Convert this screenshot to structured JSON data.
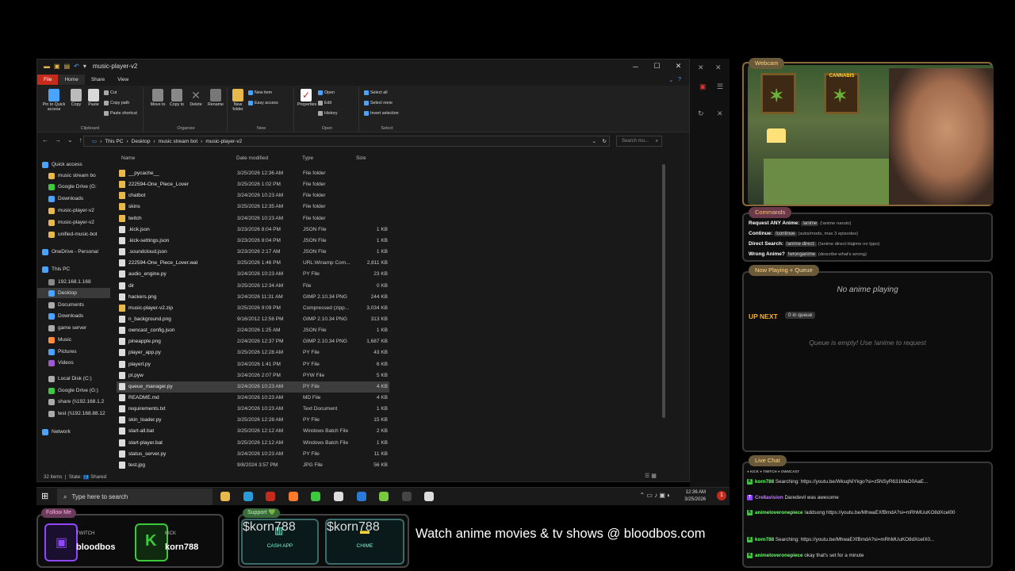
{
  "window": {
    "title": "music-player-v2",
    "controls": {
      "minimize": "─",
      "maximize": "☐",
      "close": "✕"
    }
  },
  "menu": {
    "file": "File",
    "home": "Home",
    "share": "Share",
    "view": "View"
  },
  "ribbon": {
    "pin": "Pin to Quick access",
    "copy": "Copy",
    "paste": "Paste",
    "cut": "Cut",
    "copy_path": "Copy path",
    "paste_shortcut": "Paste shortcut",
    "clipboard": "Clipboard",
    "move_to": "Move to",
    "copy_to": "Copy to",
    "delete": "Delete",
    "rename": "Rename",
    "organize": "Organize",
    "new_folder": "New folder",
    "new_item": "New item",
    "easy_access": "Easy access",
    "new": "New",
    "properties": "Properties",
    "open_btn": "Open",
    "edit": "Edit",
    "history": "History",
    "open": "Open",
    "select_all": "Select all",
    "select_none": "Select none",
    "invert": "Invert selection",
    "select": "Select"
  },
  "address": {
    "crumbs": [
      "This PC",
      "Desktop",
      "music stream bot",
      "music-player-v2"
    ],
    "search_placeholder": "Search mu..."
  },
  "nav": {
    "items": [
      {
        "label": "Quick access",
        "color": "#4aa3ff"
      },
      {
        "label": "music stream bo",
        "color": "#e8b94a"
      },
      {
        "label": "Google Drive (G:",
        "color": "#3ec83e"
      },
      {
        "label": "Downloads",
        "color": "#4aa3ff"
      },
      {
        "label": "music-player-v2",
        "color": "#e8b94a"
      },
      {
        "label": "music-player-v2",
        "color": "#e8b94a"
      },
      {
        "label": "unified-music-bot",
        "color": "#e8b94a"
      },
      {
        "label": "OneDrive - Personal",
        "color": "#4aa3ff"
      },
      {
        "label": "This PC",
        "color": "#4aa3ff"
      },
      {
        "label": "192.168.1.168",
        "color": "#888888"
      },
      {
        "label": "Desktop",
        "color": "#4aa3ff"
      },
      {
        "label": "Documents",
        "color": "#aaaaaa"
      },
      {
        "label": "Downloads",
        "color": "#4aa3ff"
      },
      {
        "label": "game server",
        "color": "#aaaaaa"
      },
      {
        "label": "Music",
        "color": "#ff8c3a"
      },
      {
        "label": "Pictures",
        "color": "#4aa3ff"
      },
      {
        "label": "Videos",
        "color": "#a05ad0"
      },
      {
        "label": "Local Disk (C:)",
        "color": "#aaaaaa"
      },
      {
        "label": "Google Drive (G:)",
        "color": "#3ec83e"
      },
      {
        "label": "share (\\\\192.168.1.2",
        "color": "#aaaaaa"
      },
      {
        "label": "test (\\\\192.168.88.12",
        "color": "#aaaaaa"
      },
      {
        "label": "Network",
        "color": "#4aa3ff"
      }
    ]
  },
  "columns": {
    "name": "Name",
    "date": "Date modified",
    "type": "Type",
    "size": "Size"
  },
  "files": [
    {
      "name": "__pycache__",
      "date": "3/25/2026 12:36 AM",
      "type": "File folder",
      "size": "",
      "color": "#e8b94a"
    },
    {
      "name": "222594-One_Piece_Lover",
      "date": "3/25/2026 1:02 PM",
      "type": "File folder",
      "size": "",
      "color": "#e8b94a"
    },
    {
      "name": "chatbot",
      "date": "3/24/2026 10:23 AM",
      "type": "File folder",
      "size": "",
      "color": "#e8b94a"
    },
    {
      "name": "skins",
      "date": "3/25/2026 12:35 AM",
      "type": "File folder",
      "size": "",
      "color": "#e8b94a"
    },
    {
      "name": "twitch",
      "date": "3/24/2026 10:23 AM",
      "type": "File folder",
      "size": "",
      "color": "#e8b94a"
    },
    {
      "name": ".kick.json",
      "date": "3/23/2026 8:04 PM",
      "type": "JSON File",
      "size": "1 KB",
      "color": "#dddddd"
    },
    {
      "name": ".kick-settings.json",
      "date": "3/23/2026 8:04 PM",
      "type": "JSON File",
      "size": "1 KB",
      "color": "#dddddd"
    },
    {
      "name": ".soundcloud.json",
      "date": "3/23/2026 2:17 AM",
      "type": "JSON File",
      "size": "1 KB",
      "color": "#dddddd"
    },
    {
      "name": "222594-One_Piece_Lover.wal",
      "date": "3/25/2026 1:46 PM",
      "type": "URL:Winamp Com...",
      "size": "2,811 KB",
      "color": "#dddddd"
    },
    {
      "name": "audio_engine.py",
      "date": "3/24/2026 10:23 AM",
      "type": "PY File",
      "size": "23 KB",
      "color": "#dddddd"
    },
    {
      "name": "dir",
      "date": "3/25/2026 12:34 AM",
      "type": "File",
      "size": "0 KB",
      "color": "#dddddd"
    },
    {
      "name": "hackers.png",
      "date": "3/24/2026 11:31 AM",
      "type": "GIMP 2.10.34 PNG",
      "size": "244 KB",
      "color": "#dddddd"
    },
    {
      "name": "music-player-v2.zip",
      "date": "3/25/2026 9:09 PM",
      "type": "Compressed (zipp...",
      "size": "3,034 KB",
      "color": "#e8b94a"
    },
    {
      "name": "n_background.png",
      "date": "9/16/2012 12:56 PM",
      "type": "GIMP 2.10.34 PNG",
      "size": "313 KB",
      "color": "#dddddd"
    },
    {
      "name": "owncast_config.json",
      "date": "2/24/2026 1:25 AM",
      "type": "JSON File",
      "size": "1 KB",
      "color": "#dddddd"
    },
    {
      "name": "pineapple.png",
      "date": "2/24/2026 12:37 PM",
      "type": "GIMP 2.10.34 PNG",
      "size": "1,687 KB",
      "color": "#dddddd"
    },
    {
      "name": "player_app.py",
      "date": "3/25/2026 12:28 AM",
      "type": "PY File",
      "size": "43 KB",
      "color": "#dddddd"
    },
    {
      "name": "playerl.py",
      "date": "3/24/2026 1:41 PM",
      "type": "PY File",
      "size": "6 KB",
      "color": "#dddddd"
    },
    {
      "name": "pt.pyw",
      "date": "3/24/2026 2:07 PM",
      "type": "PYW File",
      "size": "5 KB",
      "color": "#dddddd"
    },
    {
      "name": "queue_manager.py",
      "date": "3/24/2026 10:23 AM",
      "type": "PY File",
      "size": "4 KB",
      "color": "#dddddd"
    },
    {
      "name": "README.md",
      "date": "3/24/2026 10:23 AM",
      "type": "MD File",
      "size": "4 KB",
      "color": "#dddddd"
    },
    {
      "name": "requirements.txt",
      "date": "3/24/2026 10:23 AM",
      "type": "Text Document",
      "size": "1 KB",
      "color": "#dddddd"
    },
    {
      "name": "skin_loader.py",
      "date": "3/25/2026 12:28 AM",
      "type": "PY File",
      "size": "15 KB",
      "color": "#dddddd"
    },
    {
      "name": "start-all.bat",
      "date": "3/25/2026 12:12 AM",
      "type": "Windows Batch File",
      "size": "2 KB",
      "color": "#dddddd"
    },
    {
      "name": "start-player.bat",
      "date": "3/25/2026 12:12 AM",
      "type": "Windows Batch File",
      "size": "1 KB",
      "color": "#dddddd"
    },
    {
      "name": "status_server.py",
      "date": "3/24/2026 10:23 AM",
      "type": "PY File",
      "size": "11 KB",
      "color": "#dddddd"
    },
    {
      "name": "test.jpg",
      "date": "9/8/2024 3:57 PM",
      "type": "JPG File",
      "size": "56 KB",
      "color": "#dddddd"
    }
  ],
  "status": {
    "count": "32 items",
    "state": "State: 👥 Shared"
  },
  "taskbar": {
    "search_placeholder": "Type here to search",
    "time": "12:36 AM",
    "date": "3/25/2026",
    "apps": [
      {
        "name": "file-explorer-icon",
        "color": "#e8b94a"
      },
      {
        "name": "edge-icon",
        "color": "#2a9ad8"
      },
      {
        "name": "app-icon",
        "color": "#c42b1c"
      },
      {
        "name": "firefox-icon",
        "color": "#ff7a2a"
      },
      {
        "name": "app-icon",
        "color": "#3ec83e"
      },
      {
        "name": "obs-icon",
        "color": "#dddddd"
      },
      {
        "name": "app-icon",
        "color": "#2a7ad8"
      },
      {
        "name": "notepadpp-icon",
        "color": "#7ac83e"
      },
      {
        "name": "terminal-icon",
        "color": "#444444"
      },
      {
        "name": "file-icon",
        "color": "#dddddd"
      }
    ],
    "notifications": "1"
  },
  "overlay": {
    "webcam_tab": "Webcam",
    "poster_text": "CANNABIS",
    "commands_tab": "Commands",
    "commands": [
      {
        "label": "Request ANY Anime:",
        "code": "!anime",
        "hint": "(!anime naruto)"
      },
      {
        "label": "Continue:",
        "code": "!continue",
        "hint": "(subs/mods, max 3 episodes)"
      },
      {
        "label": "Direct Search:",
        "code": "!anime direct:",
        "hint": "(!anime direct:Hajime no Ippo)"
      },
      {
        "label": "Wrong Anime?",
        "code": "!wronganime",
        "hint": "(describe what's wrong)"
      }
    ],
    "np_tab": "Now Playing + Queue",
    "no_anime": "No anime playing",
    "up_next": "UP NEXT",
    "queue_count": "0 in queue",
    "queue_empty": "Queue is empty! Use !anime to request",
    "chat_tab": "Live Chat",
    "platforms": "● KICK  ● TWITCH  ● OWNCAST",
    "chat": [
      {
        "plat": "K",
        "user": "korn788",
        "msg": "Searching: https://youtu.be/WksqNiYkgo?si=z5NSyR631MaO0AaE..."
      },
      {
        "plat": "T",
        "user": "Cre8avision",
        "msg": "Daredevil was awesome"
      },
      {
        "plat": "K",
        "user": "animeloveronepiece",
        "msg": "!addsong https://youtu.be/MhwaEXfBmdA?si=mRhMUuKO8dXcel00"
      },
      {
        "plat": "K",
        "user": "korn788",
        "msg": "Searching: https://youtu.be/MhwaEXfBmdA?si=mRhMUuKO8dXcelX0..."
      },
      {
        "plat": "K",
        "user": "animeloveronepiece",
        "msg": "okay that's set for a minute"
      }
    ],
    "follow_tab": "Follow Me",
    "twitch_label": "TWITCH",
    "twitch_user": "bloodbos",
    "kick_label": "KICK",
    "kick_user": "korn788",
    "support_tab": "Support 💚",
    "cashapp_label": "CASH APP",
    "cashapp_user": "$korn788",
    "chime_label": "CHIME",
    "chime_user": "$korn788",
    "promo": "Watch anime movies & tv shows @ bloodbos.com"
  }
}
